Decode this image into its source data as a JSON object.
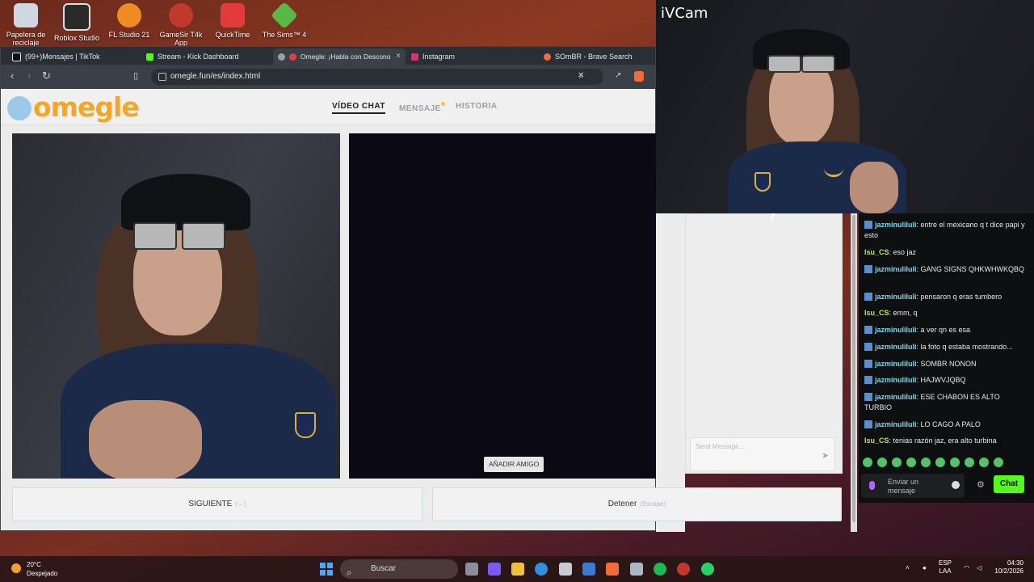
{
  "desktop": {
    "icons": [
      {
        "label": "Papelera de reciclaje",
        "color": "#cfd8e0"
      },
      {
        "label": "Roblox Studio",
        "color": "#2a2a2a"
      },
      {
        "label": "FL Studio 21",
        "color": "#f08a24"
      },
      {
        "label": "GameSir T4k App",
        "color": "#c0392b"
      },
      {
        "label": "QuickTime",
        "color": "#e23b3b"
      },
      {
        "label": "The Sims™ 4",
        "color": "#5ab845"
      }
    ]
  },
  "browser": {
    "tabs": [
      {
        "label": "(99+)Mensajes | TikTok",
        "color": "#111111"
      },
      {
        "label": "Stream - Kick Dashboard",
        "color": "#53fc18"
      },
      {
        "label": "Omegle: ¡Habla con Descono",
        "color": "#9aa0a6",
        "active": true
      },
      {
        "label": "Instagram",
        "color": "#d6336c"
      },
      {
        "label": "SOmBR - Brave Search",
        "color": "#f26b3a"
      }
    ],
    "close_tab": "×",
    "url": "omegle.fun/es/index.html"
  },
  "omegle": {
    "logo": "omegle",
    "nav": {
      "video_chat": "VÍDEO CHAT",
      "mensaje": "MENSAJE",
      "historia": "HISTORIA"
    },
    "add_friend": "AÑADIR AMIGO",
    "next_label": "SIGUIENTE",
    "next_hint": "(→)",
    "stop_label": "Detener",
    "stop_hint": "(Escape)",
    "send_placeholder": "Send Message..."
  },
  "ivcam": {
    "title": "iVCam"
  },
  "kick_chat": {
    "messages": [
      {
        "user": "jazminuliluli",
        "text": ": entre el mexicano q t dice papi y esto",
        "badge": true
      },
      {
        "user": "Isu_CS",
        "text": ": eso jaz",
        "badge": false
      },
      {
        "user": "jazminuliluli",
        "text": ": GANG SIGNS QHKWHWKQBQ",
        "badge": true
      },
      {
        "user": "jazminuliluli",
        "text": ": pensaron q eras tumbero",
        "badge": true
      },
      {
        "user": "Isu_CS",
        "text": ": emm, q",
        "badge": false
      },
      {
        "user": "jazminuliluli",
        "text": ": a ver qn es esa",
        "badge": true
      },
      {
        "user": "jazminuliluli",
        "text": ": la foto q estaba mostrando...",
        "badge": true
      },
      {
        "user": "jazminuliluli",
        "text": ": SOMBR NONON",
        "badge": true
      },
      {
        "user": "jazminuliluli",
        "text": ": HAJWVJQBQ",
        "badge": true
      },
      {
        "user": "jazminuliluli",
        "text": ": ESE CHABON ES ALTO TURBIO",
        "badge": true
      },
      {
        "user": "jazminuliluli",
        "text": ": LO CAGO A PALO",
        "badge": true
      },
      {
        "user": "Isu_CS",
        "text": ": tenias razón jaz, era alto turbina",
        "badge": false
      }
    ],
    "input_placeholder": "Enviar un mensaje",
    "chat_button": "Chat",
    "accent": "#53fc18"
  },
  "taskbar": {
    "temperature": "20°C",
    "weather": "Despejado",
    "search": "Buscar",
    "language": "ESP",
    "layout": "LAA",
    "time": "04:30",
    "date": "10/2/2026"
  }
}
